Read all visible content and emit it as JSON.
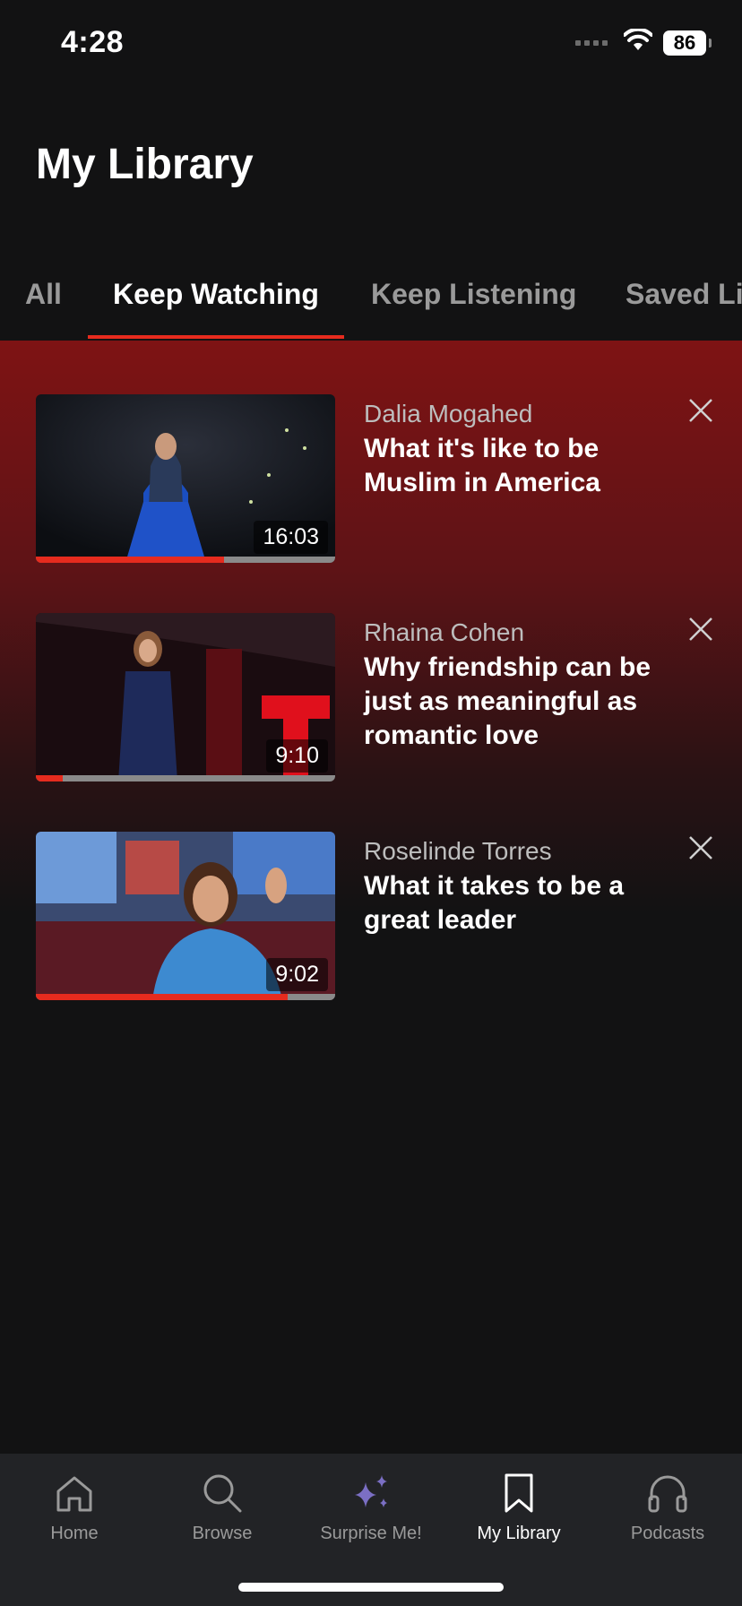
{
  "status_bar": {
    "time": "4:28",
    "battery": "86"
  },
  "header": {
    "title": "My Library"
  },
  "tabs": [
    {
      "label": "All",
      "active": false
    },
    {
      "label": "Keep Watching",
      "active": true
    },
    {
      "label": "Keep Listening",
      "active": false
    },
    {
      "label": "Saved Li",
      "active": false
    }
  ],
  "colors": {
    "accent": "#e62b1e",
    "background": "#121213",
    "tabbar": "#222326"
  },
  "talks": [
    {
      "speaker": "Dalia Mogahed",
      "title": "What it's like to be Muslim in America",
      "duration": "16:03",
      "progress": 0.63
    },
    {
      "speaker": "Rhaina Cohen",
      "title": "Why friendship can be just as meaningful as romantic love",
      "duration": "9:10",
      "progress": 0.09
    },
    {
      "speaker": "Roselinde Torres",
      "title": "What it takes to be a great leader",
      "duration": "9:02",
      "progress": 0.84
    }
  ],
  "tab_bar": [
    {
      "label": "Home",
      "icon": "home-icon",
      "active": false
    },
    {
      "label": "Browse",
      "icon": "search-icon",
      "active": false
    },
    {
      "label": "Surprise Me!",
      "icon": "sparkle-icon",
      "active": false
    },
    {
      "label": "My Library",
      "icon": "bookmark-icon",
      "active": true
    },
    {
      "label": "Podcasts",
      "icon": "headphones-icon",
      "active": false
    }
  ]
}
